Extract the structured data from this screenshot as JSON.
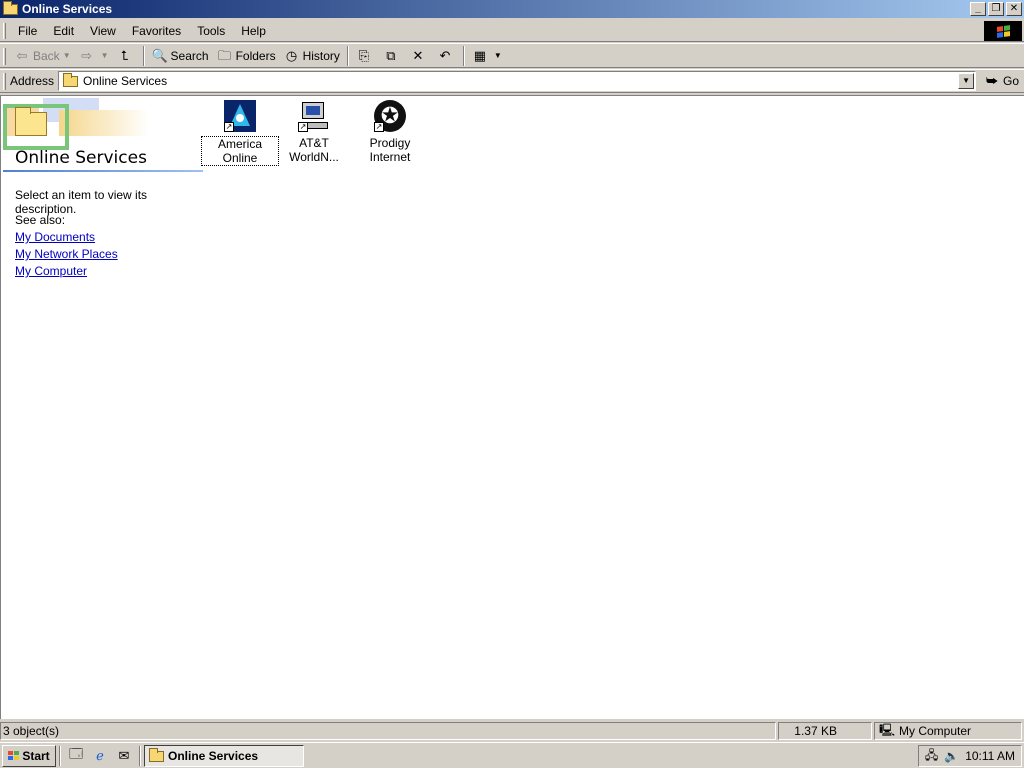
{
  "window": {
    "title": "Online Services"
  },
  "menu": [
    "File",
    "Edit",
    "View",
    "Favorites",
    "Tools",
    "Help"
  ],
  "toolbar": {
    "back": "Back",
    "search": "Search",
    "folders": "Folders",
    "history": "History"
  },
  "address": {
    "label": "Address",
    "value": "Online Services",
    "go": "Go"
  },
  "webview": {
    "title": "Online Services",
    "description": "Select an item to view its description.",
    "see_also": "See also:",
    "links": [
      "My Documents",
      "My Network Places",
      "My Computer"
    ]
  },
  "items": [
    {
      "label": "America Online",
      "icon": "aol-icon"
    },
    {
      "label": "AT&T WorldN...",
      "icon": "att-worldnet-icon"
    },
    {
      "label": "Prodigy Internet",
      "icon": "prodigy-icon"
    }
  ],
  "status": {
    "objects": "3 object(s)",
    "size": "1.37 KB",
    "zone": "My Computer"
  },
  "taskbar": {
    "start": "Start",
    "task": "Online Services",
    "clock": "10:11 AM"
  },
  "colors": {
    "title_start": "#0a246a",
    "title_end": "#a6caf0",
    "link": "#0000c0"
  }
}
